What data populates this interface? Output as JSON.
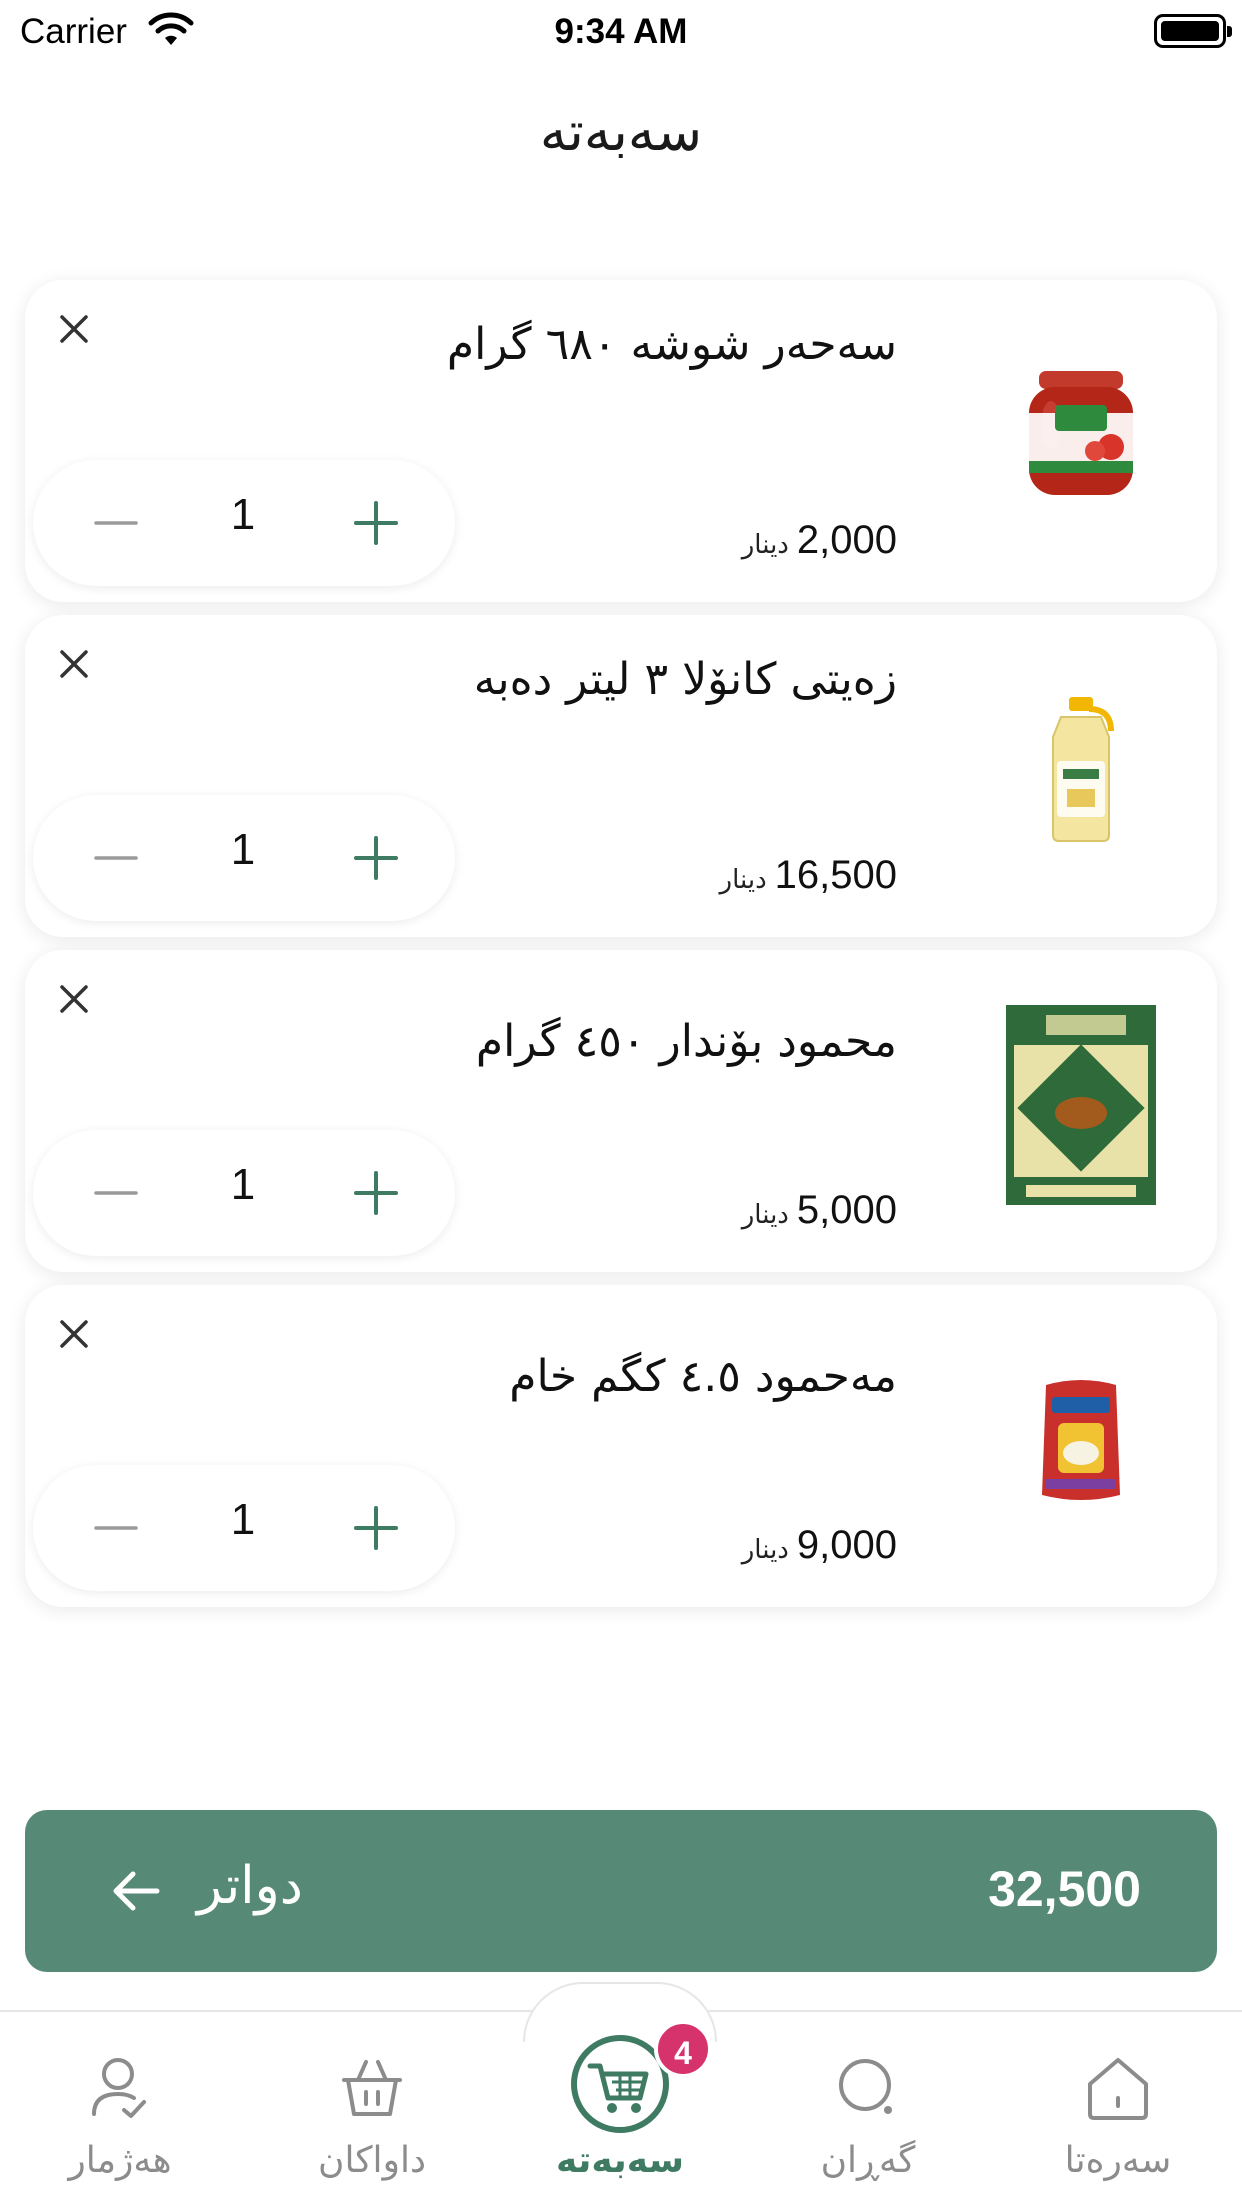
{
  "status_bar": {
    "carrier": "Carrier",
    "time": "9:34 AM"
  },
  "header": {
    "title": "سەبەتە"
  },
  "currency": "دینار",
  "cart": {
    "items": [
      {
        "name": "سەحەر شوشە ٦٨٠ گرام",
        "price": "2,000",
        "quantity": "1",
        "image": "tomato-paste-jar"
      },
      {
        "name": "زەیتی  کانۆلا ٣ لیتر دەبە",
        "price": "16,500",
        "quantity": "1",
        "image": "oil-bottle"
      },
      {
        "name": "محمود بۆندار ٤٥٠ گرام",
        "price": "5,000",
        "quantity": "1",
        "image": "tea-box"
      },
      {
        "name": "مەحمود ٤.٥ کگم خام",
        "price": "9,000",
        "quantity": "1",
        "image": "rice-bag"
      }
    ]
  },
  "checkout": {
    "next_label": "دواتر",
    "total": "32,500"
  },
  "tabs": [
    {
      "label": "هەژمار",
      "icon": "user-icon"
    },
    {
      "label": "داواکان",
      "icon": "basket-icon"
    },
    {
      "label": "سەبەتە",
      "icon": "cart-icon",
      "badge": "4",
      "active": true
    },
    {
      "label": "گەڕان",
      "icon": "search-icon"
    },
    {
      "label": "سەرەتا",
      "icon": "home-icon"
    }
  ],
  "colors": {
    "accent": "#568a77",
    "accent_text": "#3f7a63",
    "badge": "#d6336c"
  }
}
